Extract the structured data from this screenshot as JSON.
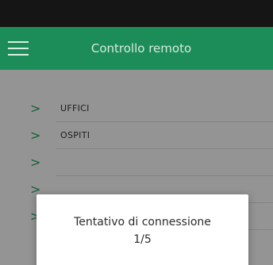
{
  "header": {
    "title": "Controllo remoto",
    "menu_icon": "hamburger-menu-icon",
    "background": "#1c8d58"
  },
  "list": {
    "items": [
      {
        "label": "UFFICI",
        "icon": "chevron-right-icon"
      },
      {
        "label": "OSPITI",
        "icon": "chevron-right-icon"
      },
      {
        "label": "",
        "icon": "chevron-right-icon"
      },
      {
        "label": "",
        "icon": "chevron-right-icon"
      },
      {
        "label": "",
        "icon": "chevron-right-icon"
      }
    ],
    "chevron_color": "#2aa56a"
  },
  "dialog": {
    "line1": "Tentativo di connessione",
    "line2": "1/5"
  }
}
